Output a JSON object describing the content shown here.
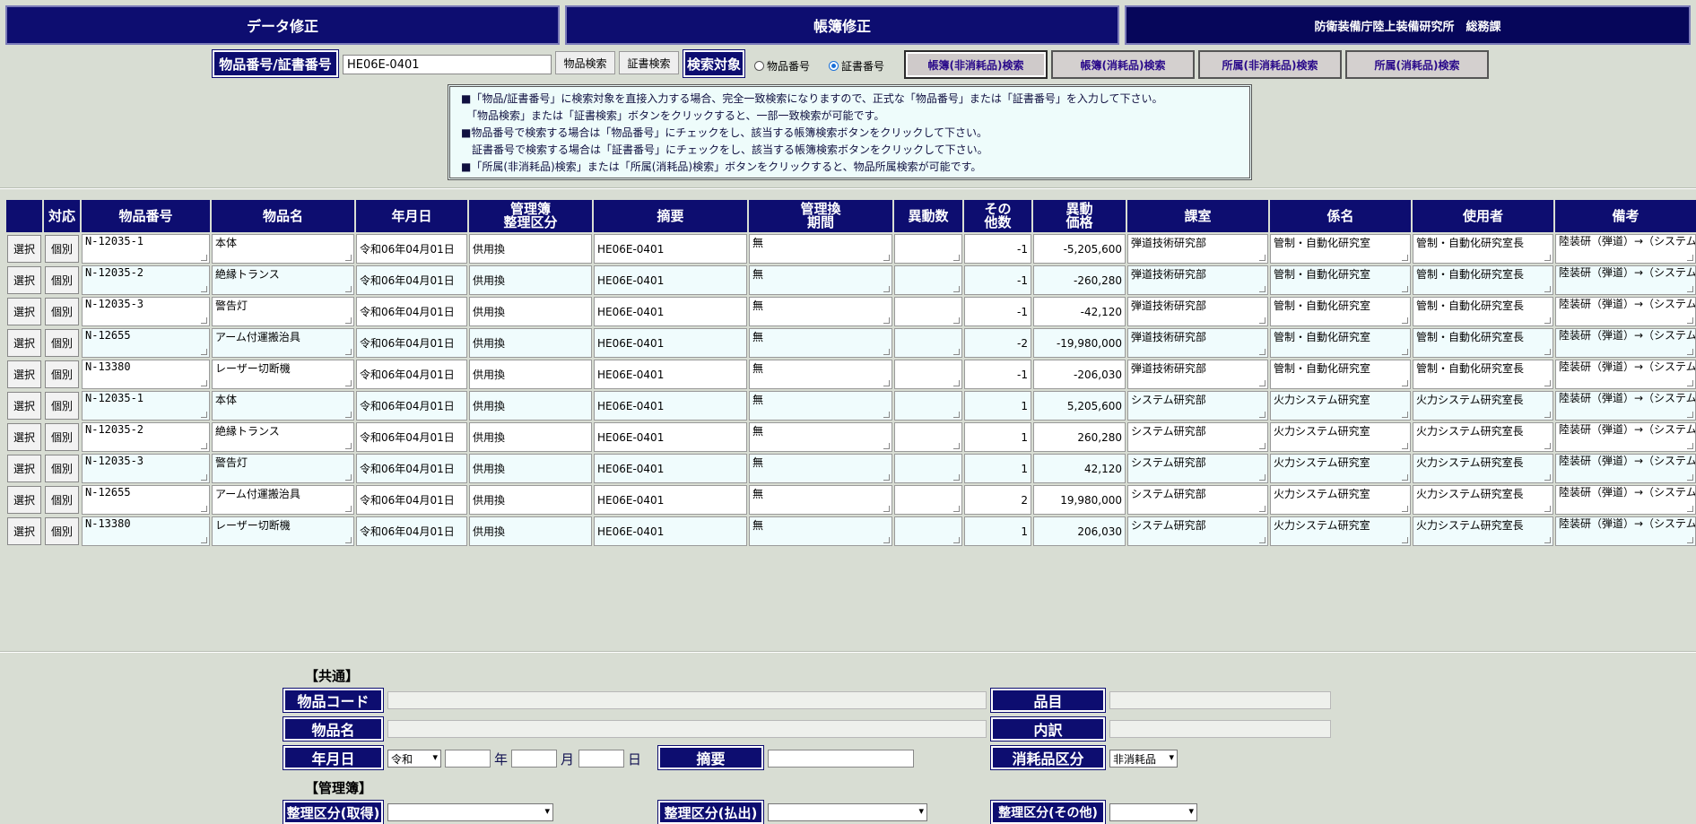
{
  "top_tabs": {
    "data_fix": "データ修正",
    "ledger_fix": "帳簿修正",
    "org": "防衛装備庁陸上装備研究所　総務課"
  },
  "search": {
    "label": "物品番号/証書番号",
    "value": "HE06E-0401",
    "btn_item": "物品検索",
    "btn_cert": "証書検索",
    "target_label": "検索対象",
    "radio_item": "物品番号",
    "radio_cert": "証書番号",
    "ledger_buttons": [
      "帳簿(非消耗品)検索",
      "帳簿(消耗品)検索",
      "所属(非消耗品)検索",
      "所属(消耗品)検索"
    ]
  },
  "info": [
    "■「物品/証書番号」に検索対象を直接入力する場合、完全一致検索になりますので、正式な「物品番号」または「証書番号」を入力して下さい。",
    "　「物品検索」または「証書検索」ボタンをクリックすると、一部一致検索が可能です。",
    "■物品番号で検索する場合は「物品番号」にチェックをし、該当する帳簿検索ボタンをクリックして下さい。",
    "　証書番号で検索する場合は「証書番号」にチェックをし、該当する帳簿検索ボタンをクリックして下さい。",
    "■「所属(非消耗品)検索」または「所属(消耗品)検索」ボタンをクリックすると、物品所属検索が可能です。"
  ],
  "table": {
    "headers": [
      "",
      "対応",
      "物品番号",
      "物品名",
      "年月日",
      "管理簿\n整理区分",
      "摘要",
      "管理換\n期間",
      "異動数",
      "その\n他数",
      "異動\n価格",
      "課室",
      "係名",
      "使用者",
      "備考"
    ],
    "select_label": "選択",
    "detail_label": "個別",
    "rows": [
      [
        "N-12035-1",
        "本体",
        "令和06年04月01日",
        "供用換",
        "HE06E-0401",
        "無",
        "",
        "-1",
        "-5,205,600",
        "弾道技術研究部",
        "管制・自動化研究室",
        "管制・自動化研究室長",
        "陸装研（弾道）→（システム）"
      ],
      [
        "N-12035-2",
        "絶縁トランス",
        "令和06年04月01日",
        "供用換",
        "HE06E-0401",
        "無",
        "",
        "-1",
        "-260,280",
        "弾道技術研究部",
        "管制・自動化研究室",
        "管制・自動化研究室長",
        "陸装研（弾道）→（システム）"
      ],
      [
        "N-12035-3",
        "警告灯",
        "令和06年04月01日",
        "供用換",
        "HE06E-0401",
        "無",
        "",
        "-1",
        "-42,120",
        "弾道技術研究部",
        "管制・自動化研究室",
        "管制・自動化研究室長",
        "陸装研（弾道）→（システム）"
      ],
      [
        "N-12655",
        "アーム付運搬治具",
        "令和06年04月01日",
        "供用換",
        "HE06E-0401",
        "無",
        "",
        "-2",
        "-19,980,000",
        "弾道技術研究部",
        "管制・自動化研究室",
        "管制・自動化研究室長",
        "陸装研（弾道）→（システム）"
      ],
      [
        "N-13380",
        "レーザー切断機",
        "令和06年04月01日",
        "供用換",
        "HE06E-0401",
        "無",
        "",
        "-1",
        "-206,030",
        "弾道技術研究部",
        "管制・自動化研究室",
        "管制・自動化研究室長",
        "陸装研（弾道）→（システム）"
      ],
      [
        "N-12035-1",
        "本体",
        "令和06年04月01日",
        "供用換",
        "HE06E-0401",
        "無",
        "",
        "1",
        "5,205,600",
        "システム研究部",
        "火力システム研究室",
        "火力システム研究室長",
        "陸装研（弾道）→（システム）"
      ],
      [
        "N-12035-2",
        "絶縁トランス",
        "令和06年04月01日",
        "供用換",
        "HE06E-0401",
        "無",
        "",
        "1",
        "260,280",
        "システム研究部",
        "火力システム研究室",
        "火力システム研究室長",
        "陸装研（弾道）→（システム）"
      ],
      [
        "N-12035-3",
        "警告灯",
        "令和06年04月01日",
        "供用換",
        "HE06E-0401",
        "無",
        "",
        "1",
        "42,120",
        "システム研究部",
        "火力システム研究室",
        "火力システム研究室長",
        "陸装研（弾道）→（システム）"
      ],
      [
        "N-12655",
        "アーム付運搬治具",
        "令和06年04月01日",
        "供用換",
        "HE06E-0401",
        "無",
        "",
        "2",
        "19,980,000",
        "システム研究部",
        "火力システム研究室",
        "火力システム研究室長",
        "陸装研（弾道）→（システム）"
      ],
      [
        "N-13380",
        "レーザー切断機",
        "令和06年04月01日",
        "供用換",
        "HE06E-0401",
        "無",
        "",
        "1",
        "206,030",
        "システム研究部",
        "火力システム研究室",
        "火力システム研究室長",
        "陸装研（弾道）→（システム）"
      ]
    ]
  },
  "form": {
    "common_title": "【共通】",
    "item_code": "物品コード",
    "item_name": "物品名",
    "date": "年月日",
    "era": "令和",
    "year_unit": "年",
    "month_unit": "月",
    "day_unit": "日",
    "summary": "摘要",
    "hinmoku": "品目",
    "breakdown": "内訳",
    "consumable_class": "消耗品区分",
    "consumable_value": "非消耗品",
    "ledger_title": "【管理簿】",
    "class_acq": "整理区分(取得)",
    "class_pay": "整理区分(払出)",
    "class_other": "整理区分(その他)"
  }
}
